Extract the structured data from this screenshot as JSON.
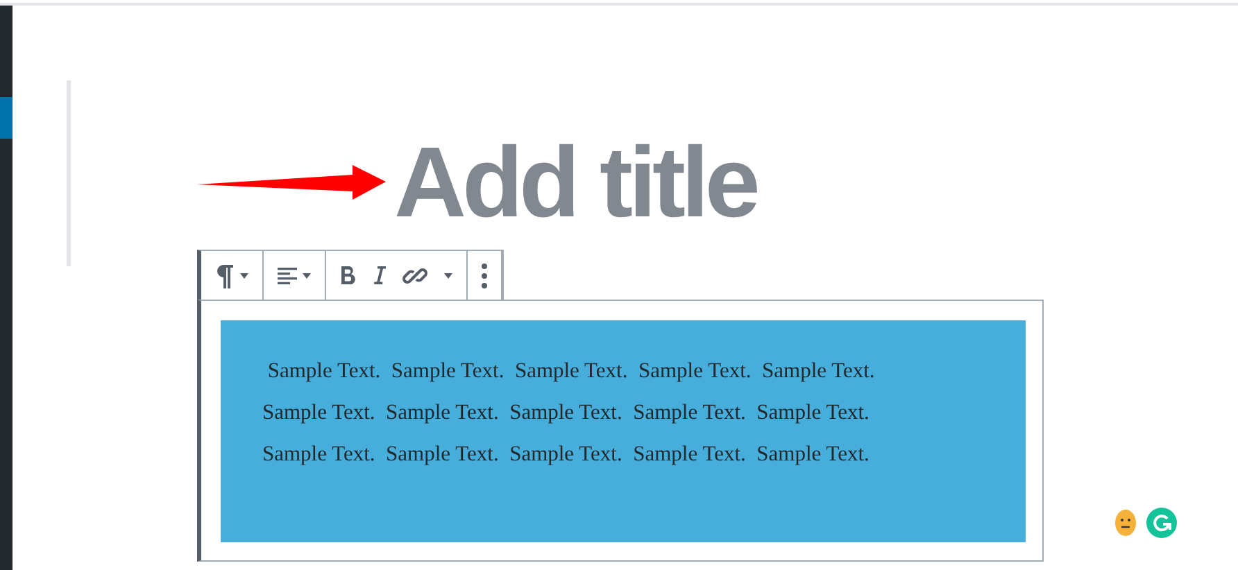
{
  "title": {
    "placeholder": "Add title"
  },
  "toolbar": {
    "groups": [
      [
        {
          "kind": "paragraph",
          "caret": true
        }
      ],
      [
        {
          "kind": "align",
          "caret": true
        }
      ],
      [
        {
          "kind": "bold"
        },
        {
          "kind": "italic"
        },
        {
          "kind": "link"
        },
        {
          "kind": "more-caret"
        }
      ],
      [
        {
          "kind": "options"
        }
      ]
    ]
  },
  "block": {
    "text": " Sample Text.  Sample Text.  Sample Text.  Sample Text.  Sample Text.  Sample Text.  Sample Text.  Sample Text.  Sample Text.  Sample Text.  Sample Text.  Sample Text.  Sample Text.  Sample Text.  Sample Text."
  }
}
